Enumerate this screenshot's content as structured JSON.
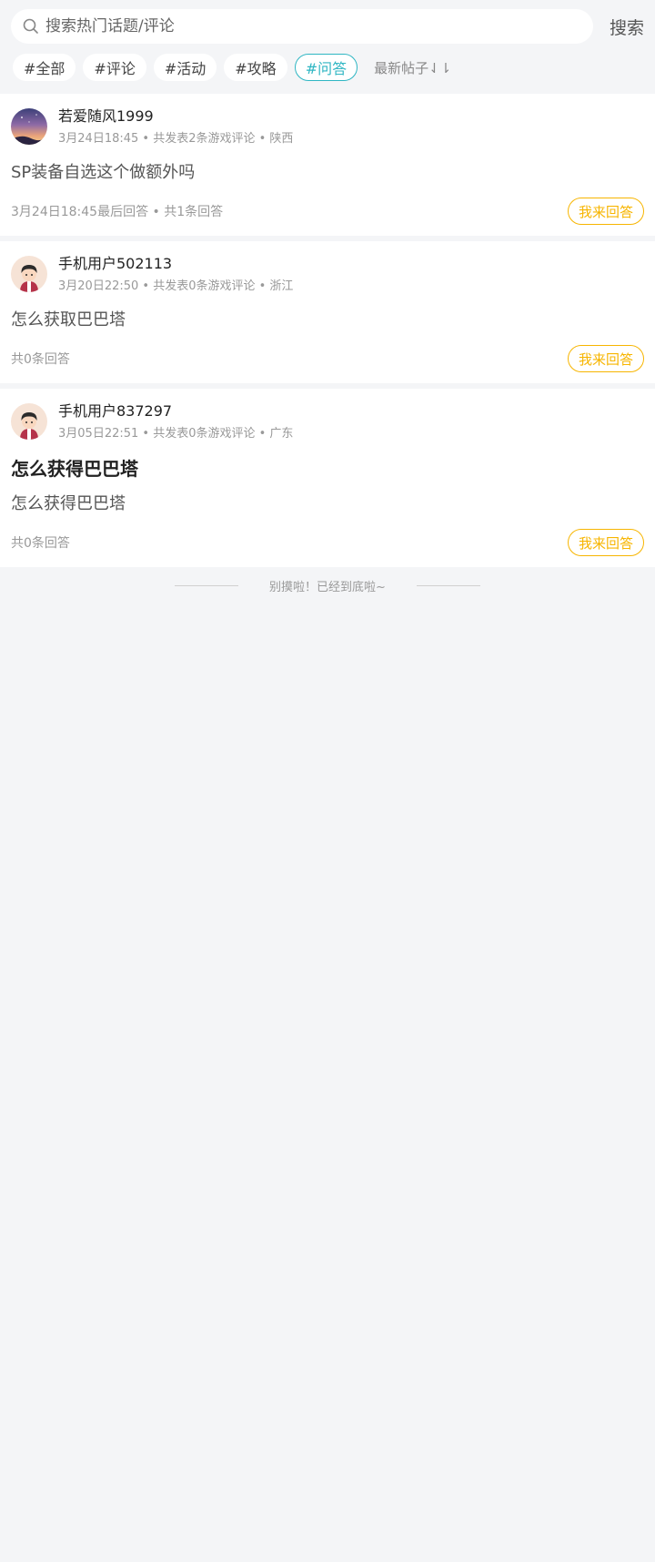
{
  "search": {
    "placeholder": "搜索热门话题/评论",
    "button_label": "搜索"
  },
  "tags": [
    {
      "label": "#全部",
      "active": false
    },
    {
      "label": "#评论",
      "active": false
    },
    {
      "label": "#活动",
      "active": false
    },
    {
      "label": "#攻略",
      "active": false
    },
    {
      "label": "#问答",
      "active": true
    }
  ],
  "sort": {
    "label": "最新帖子⇃⇂"
  },
  "posts": [
    {
      "author": "若爱随风1999",
      "meta": "3月24日18:45 • 共发表2条游戏评论 • 陕西",
      "title": "",
      "content": "SP装备自选这个做额外吗",
      "footer": "3月24日18:45最后回答 • 共1条回答",
      "answer_label": "我来回答"
    },
    {
      "author": "手机用户502113",
      "meta": "3月20日22:50 • 共发表0条游戏评论 • 浙江",
      "title": "",
      "content": "怎么获取巴巴塔",
      "footer": "共0条回答",
      "answer_label": "我来回答"
    },
    {
      "author": "手机用户837297",
      "meta": "3月05日22:51 • 共发表0条游戏评论 • 广东",
      "title": "怎么获得巴巴塔",
      "content": "怎么获得巴巴塔",
      "footer": "共0条回答",
      "answer_label": "我来回答"
    }
  ],
  "end_text": "别摸啦！已经到底啦~",
  "colors": {
    "accent_active_tag": "#2fb6c3",
    "answer_button": "#f7b500",
    "background": "#f4f5f7"
  }
}
